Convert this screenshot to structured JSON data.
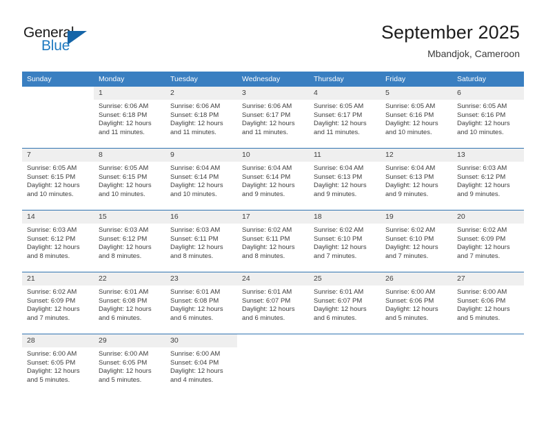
{
  "brand": {
    "name_primary": "General",
    "name_secondary": "Blue",
    "logo_icon": "triangle-logo-icon",
    "primary_color": "#1a1a1a",
    "secondary_color": "#1f7ac0",
    "triangle_color": "#1565a8"
  },
  "header": {
    "title": "September 2025",
    "subtitle": "Mbandjok, Cameroon"
  },
  "theme": {
    "header_row_bg": "#3a7fc1",
    "daynum_bg": "#efefef",
    "week_separator": "#2e72b0",
    "text": "#3c3c3c"
  },
  "calendar": {
    "weekday_headers": [
      "Sunday",
      "Monday",
      "Tuesday",
      "Wednesday",
      "Thursday",
      "Friday",
      "Saturday"
    ],
    "weeks": [
      [
        {
          "day": "",
          "lines": []
        },
        {
          "day": "1",
          "lines": [
            "Sunrise: 6:06 AM",
            "Sunset: 6:18 PM",
            "Daylight: 12 hours",
            "and 11 minutes."
          ]
        },
        {
          "day": "2",
          "lines": [
            "Sunrise: 6:06 AM",
            "Sunset: 6:18 PM",
            "Daylight: 12 hours",
            "and 11 minutes."
          ]
        },
        {
          "day": "3",
          "lines": [
            "Sunrise: 6:06 AM",
            "Sunset: 6:17 PM",
            "Daylight: 12 hours",
            "and 11 minutes."
          ]
        },
        {
          "day": "4",
          "lines": [
            "Sunrise: 6:05 AM",
            "Sunset: 6:17 PM",
            "Daylight: 12 hours",
            "and 11 minutes."
          ]
        },
        {
          "day": "5",
          "lines": [
            "Sunrise: 6:05 AM",
            "Sunset: 6:16 PM",
            "Daylight: 12 hours",
            "and 10 minutes."
          ]
        },
        {
          "day": "6",
          "lines": [
            "Sunrise: 6:05 AM",
            "Sunset: 6:16 PM",
            "Daylight: 12 hours",
            "and 10 minutes."
          ]
        }
      ],
      [
        {
          "day": "7",
          "lines": [
            "Sunrise: 6:05 AM",
            "Sunset: 6:15 PM",
            "Daylight: 12 hours",
            "and 10 minutes."
          ]
        },
        {
          "day": "8",
          "lines": [
            "Sunrise: 6:05 AM",
            "Sunset: 6:15 PM",
            "Daylight: 12 hours",
            "and 10 minutes."
          ]
        },
        {
          "day": "9",
          "lines": [
            "Sunrise: 6:04 AM",
            "Sunset: 6:14 PM",
            "Daylight: 12 hours",
            "and 10 minutes."
          ]
        },
        {
          "day": "10",
          "lines": [
            "Sunrise: 6:04 AM",
            "Sunset: 6:14 PM",
            "Daylight: 12 hours",
            "and 9 minutes."
          ]
        },
        {
          "day": "11",
          "lines": [
            "Sunrise: 6:04 AM",
            "Sunset: 6:13 PM",
            "Daylight: 12 hours",
            "and 9 minutes."
          ]
        },
        {
          "day": "12",
          "lines": [
            "Sunrise: 6:04 AM",
            "Sunset: 6:13 PM",
            "Daylight: 12 hours",
            "and 9 minutes."
          ]
        },
        {
          "day": "13",
          "lines": [
            "Sunrise: 6:03 AM",
            "Sunset: 6:12 PM",
            "Daylight: 12 hours",
            "and 9 minutes."
          ]
        }
      ],
      [
        {
          "day": "14",
          "lines": [
            "Sunrise: 6:03 AM",
            "Sunset: 6:12 PM",
            "Daylight: 12 hours",
            "and 8 minutes."
          ]
        },
        {
          "day": "15",
          "lines": [
            "Sunrise: 6:03 AM",
            "Sunset: 6:12 PM",
            "Daylight: 12 hours",
            "and 8 minutes."
          ]
        },
        {
          "day": "16",
          "lines": [
            "Sunrise: 6:03 AM",
            "Sunset: 6:11 PM",
            "Daylight: 12 hours",
            "and 8 minutes."
          ]
        },
        {
          "day": "17",
          "lines": [
            "Sunrise: 6:02 AM",
            "Sunset: 6:11 PM",
            "Daylight: 12 hours",
            "and 8 minutes."
          ]
        },
        {
          "day": "18",
          "lines": [
            "Sunrise: 6:02 AM",
            "Sunset: 6:10 PM",
            "Daylight: 12 hours",
            "and 7 minutes."
          ]
        },
        {
          "day": "19",
          "lines": [
            "Sunrise: 6:02 AM",
            "Sunset: 6:10 PM",
            "Daylight: 12 hours",
            "and 7 minutes."
          ]
        },
        {
          "day": "20",
          "lines": [
            "Sunrise: 6:02 AM",
            "Sunset: 6:09 PM",
            "Daylight: 12 hours",
            "and 7 minutes."
          ]
        }
      ],
      [
        {
          "day": "21",
          "lines": [
            "Sunrise: 6:02 AM",
            "Sunset: 6:09 PM",
            "Daylight: 12 hours",
            "and 7 minutes."
          ]
        },
        {
          "day": "22",
          "lines": [
            "Sunrise: 6:01 AM",
            "Sunset: 6:08 PM",
            "Daylight: 12 hours",
            "and 6 minutes."
          ]
        },
        {
          "day": "23",
          "lines": [
            "Sunrise: 6:01 AM",
            "Sunset: 6:08 PM",
            "Daylight: 12 hours",
            "and 6 minutes."
          ]
        },
        {
          "day": "24",
          "lines": [
            "Sunrise: 6:01 AM",
            "Sunset: 6:07 PM",
            "Daylight: 12 hours",
            "and 6 minutes."
          ]
        },
        {
          "day": "25",
          "lines": [
            "Sunrise: 6:01 AM",
            "Sunset: 6:07 PM",
            "Daylight: 12 hours",
            "and 6 minutes."
          ]
        },
        {
          "day": "26",
          "lines": [
            "Sunrise: 6:00 AM",
            "Sunset: 6:06 PM",
            "Daylight: 12 hours",
            "and 5 minutes."
          ]
        },
        {
          "day": "27",
          "lines": [
            "Sunrise: 6:00 AM",
            "Sunset: 6:06 PM",
            "Daylight: 12 hours",
            "and 5 minutes."
          ]
        }
      ],
      [
        {
          "day": "28",
          "lines": [
            "Sunrise: 6:00 AM",
            "Sunset: 6:05 PM",
            "Daylight: 12 hours",
            "and 5 minutes."
          ]
        },
        {
          "day": "29",
          "lines": [
            "Sunrise: 6:00 AM",
            "Sunset: 6:05 PM",
            "Daylight: 12 hours",
            "and 5 minutes."
          ]
        },
        {
          "day": "30",
          "lines": [
            "Sunrise: 6:00 AM",
            "Sunset: 6:04 PM",
            "Daylight: 12 hours",
            "and 4 minutes."
          ]
        },
        {
          "day": "",
          "lines": []
        },
        {
          "day": "",
          "lines": []
        },
        {
          "day": "",
          "lines": []
        },
        {
          "day": "",
          "lines": []
        }
      ]
    ]
  }
}
